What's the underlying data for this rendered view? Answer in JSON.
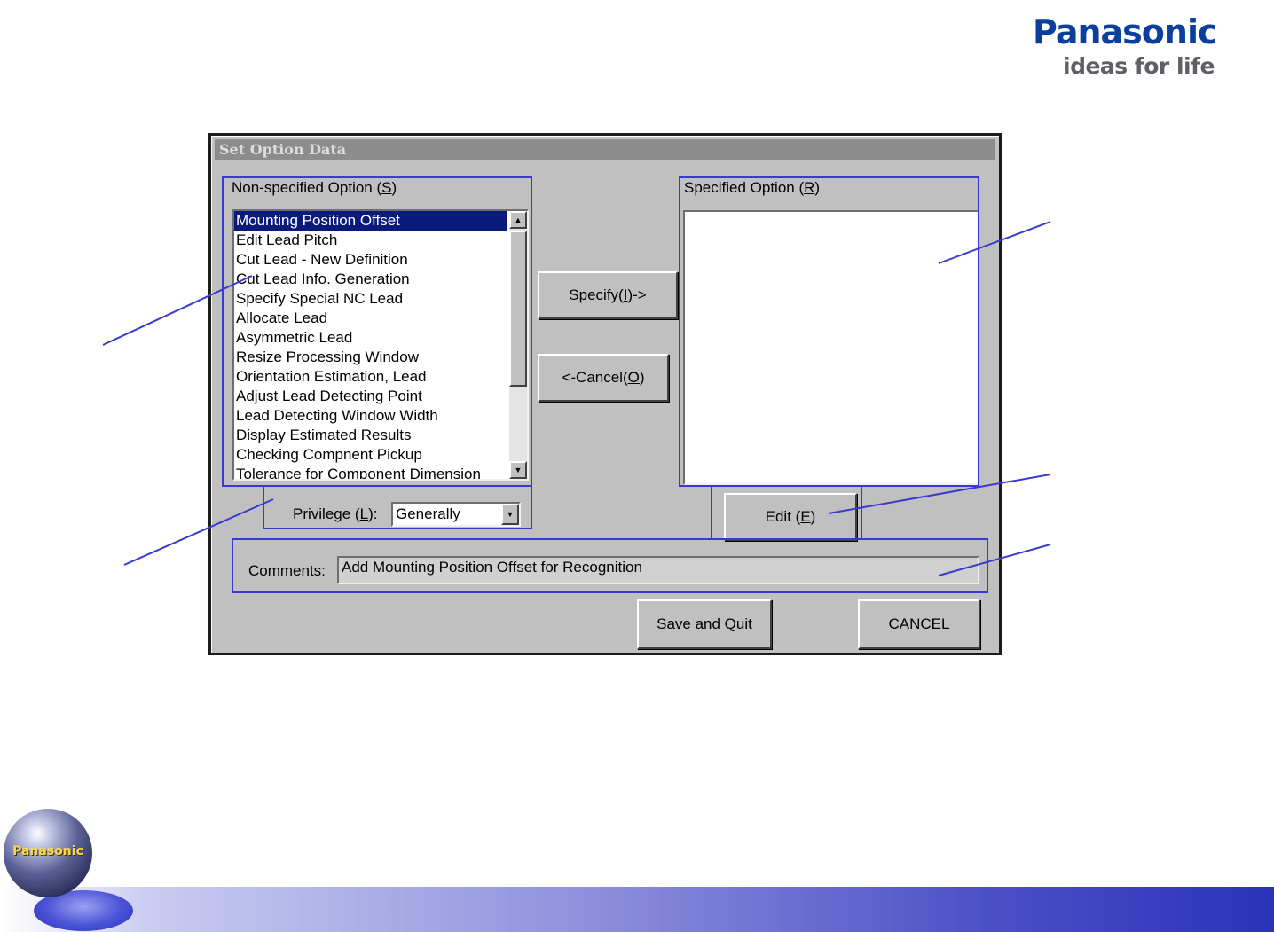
{
  "brand": {
    "name": "Panasonic",
    "tagline": "ideas for life",
    "globe_label": "Panasonic",
    "colors": {
      "name": "#0b3f9e",
      "tagline": "#5e6066",
      "callout": "#3a3ad0",
      "selection": "#0a1a7a"
    }
  },
  "dialog": {
    "title": "Set Option Data",
    "non_specified": {
      "label_text": "Non-specified Option (",
      "label_key": "S",
      "label_end": ")",
      "items": [
        "Mounting Position Offset",
        "Edit Lead Pitch",
        "Cut Lead - New Definition",
        "Cut Lead Info. Generation",
        "Specify Special NC Lead",
        "Allocate Lead",
        "Asymmetric Lead",
        "Resize Processing Window",
        "Orientation Estimation, Lead",
        "Adjust Lead Detecting Point",
        "Lead Detecting Window Width",
        "Display Estimated Results",
        "Checking Compnent Pickup",
        "Tolerance for Component Dimension"
      ],
      "selected_index": 0
    },
    "specified": {
      "label_text": "Specified Option (",
      "label_key": "R",
      "label_end": ")",
      "items": []
    },
    "specify_button": {
      "text": "Specify(",
      "key": "I",
      "end": ")->"
    },
    "cancel_move_button": {
      "text": "<-Cancel(",
      "key": "O",
      "end": ")"
    },
    "privilege": {
      "label_text": "Privilege (",
      "label_key": "L",
      "label_end": "):",
      "value": "Generally"
    },
    "edit_button": {
      "text": "Edit (",
      "key": "E",
      "end": ")"
    },
    "comments": {
      "label": "Comments:",
      "value": "Add Mounting Position Offset for Recognition"
    },
    "save_button": "Save and Quit",
    "cancel_button": "CANCEL",
    "scroll_icons": {
      "up": "scroll-up-arrow-icon",
      "down": "scroll-down-arrow-icon"
    }
  }
}
